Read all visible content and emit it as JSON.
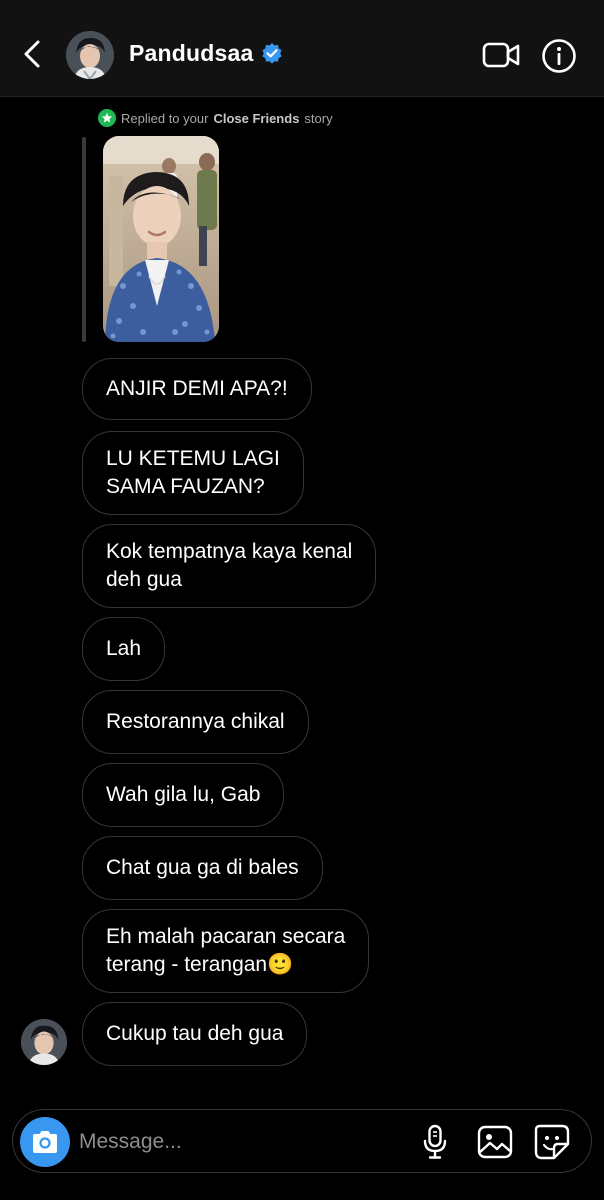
{
  "header": {
    "username": "Pandudsaa",
    "verified": true,
    "icons": [
      "back-arrow-icon",
      "verified-badge-icon",
      "video-call-icon",
      "info-icon"
    ]
  },
  "story_reply": {
    "label_prefix": "Replied to your",
    "label_bold": "Close Friends",
    "label_suffix": "story",
    "badge_color": "#1db954"
  },
  "messages": [
    {
      "lines": [
        "ANJIR DEMI APA?!"
      ]
    },
    {
      "lines": [
        "LU KETEMU LAGI",
        "SAMA FAUZAN?"
      ]
    },
    {
      "lines": [
        "Kok tempatnya kaya kenal",
        "deh gua"
      ]
    },
    {
      "lines": [
        "Lah"
      ]
    },
    {
      "lines": [
        "Restorannya chikal"
      ]
    },
    {
      "lines": [
        "Wah gila lu, Gab"
      ]
    },
    {
      "lines": [
        "Chat gua ga di bales"
      ]
    },
    {
      "lines": [
        "Eh malah pacaran secara",
        "terang - terangan🙂"
      ]
    },
    {
      "lines": [
        "Cukup tau deh gua"
      ]
    }
  ],
  "composer": {
    "placeholder": "Message...",
    "camera_color": "#3897f0",
    "icons": [
      "camera-icon",
      "microphone-icon",
      "gallery-icon",
      "sticker-icon"
    ]
  },
  "colors": {
    "background": "#000000",
    "header": "#121212",
    "bubble_border": "#363636",
    "verified": "#3897f0"
  }
}
